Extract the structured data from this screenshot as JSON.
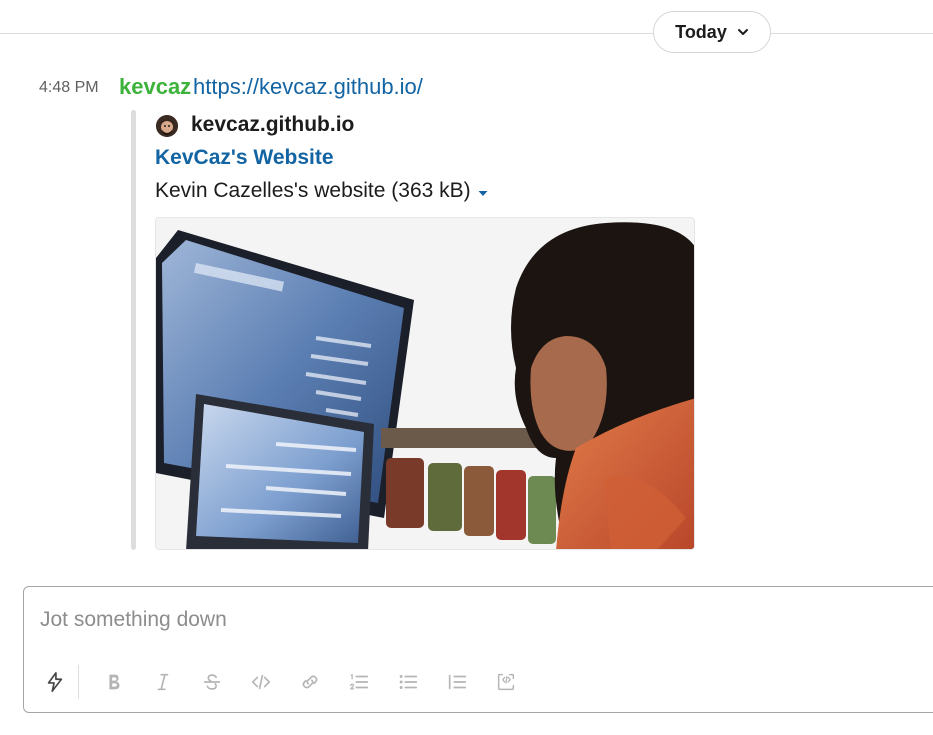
{
  "date_divider": {
    "label": "Today"
  },
  "message": {
    "timestamp": "4:48 PM",
    "sender": "kevcaz",
    "link_text": "https://kevcaz.github.io/"
  },
  "attachment": {
    "site_name": "kevcaz.github.io",
    "title": "KevCaz's Website",
    "file_description": "Kevin Cazelles's website (363 kB)"
  },
  "composer": {
    "placeholder": "Jot something down",
    "toolbar": [
      "shortcuts-icon",
      "bold-icon",
      "italic-icon",
      "strikethrough-icon",
      "code-icon",
      "link-icon",
      "numbered-list-icon",
      "bulleted-list-icon",
      "blockquote-icon",
      "code-block-icon"
    ]
  },
  "colors": {
    "sender": "#3db33b",
    "link": "#1264a3",
    "divider": "#dddddd",
    "toolbar_icon": "#b5b5b5"
  }
}
